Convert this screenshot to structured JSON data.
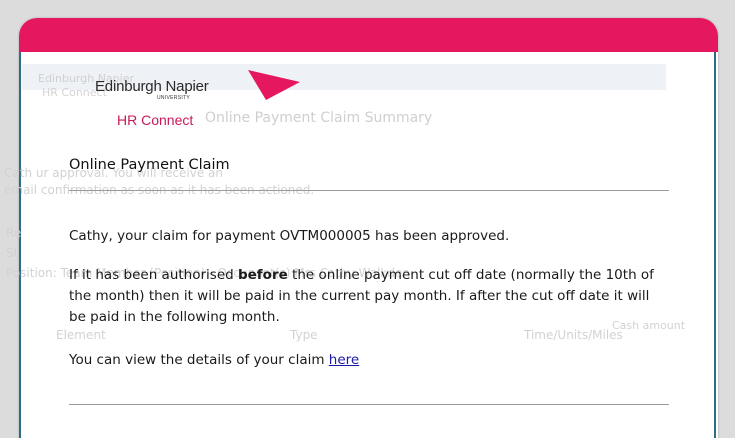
{
  "colors": {
    "band": "#e5185f",
    "accent": "#c8195b",
    "frame_border": "#2f6a86",
    "link": "#1a1aa6"
  },
  "logo": {
    "name": "Edinburgh Napier",
    "sub": "UNIVERSITY"
  },
  "app_name": "HR Connect",
  "background": {
    "logo_line1": "Edinburgh Napier",
    "logo_line2": "HR Connect",
    "summary_title": "Online Payment Claim Summary",
    "line1": "Cath                                                                                                   ur approval. You will receive an",
    "line2": "email confirmation as soon as it has been actioned.",
    "re": "Re",
    "st": "St",
    "position": "Position: Team Member (Position) - Occupant(s) Mrs Cathy Walkden",
    "col_element": "Element",
    "col_type": "Type",
    "col_units": "Time/Units/Miles",
    "col_cash": "Cash amount"
  },
  "modal": {
    "heading": "Online Payment Claim",
    "approved_text": "Cathy, your claim for payment OVTM000005 has been approved.",
    "para_prefix": "If it has been authorised ",
    "para_bold": "before",
    "para_suffix": " the online payment cut off date (normally the 10th of the month) then it will be paid in the current pay month. If after the cut off date it will be paid in the following month.",
    "view_prefix": "You can view the details of your claim ",
    "view_link": "here"
  }
}
